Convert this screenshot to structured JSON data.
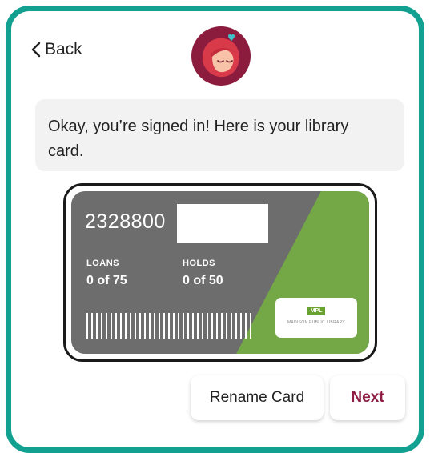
{
  "header": {
    "back_label": "Back"
  },
  "message": {
    "text": "Okay, you’re signed in! Here is your library card."
  },
  "card": {
    "number": "2328800",
    "loans_label": "LOANS",
    "loans_value": "0 of 75",
    "holds_label": "HOLDS",
    "holds_value": "0 of 50",
    "library_mark": "MPL",
    "library_name": "MADISON PUBLIC LIBRARY"
  },
  "actions": {
    "rename_label": "Rename Card",
    "next_label": "Next"
  },
  "colors": {
    "frame": "#12a191",
    "card_gray": "#6d6d6d",
    "card_green": "#74a847",
    "accent": "#8f1d44",
    "logo_bg": "#8b1c3e"
  }
}
